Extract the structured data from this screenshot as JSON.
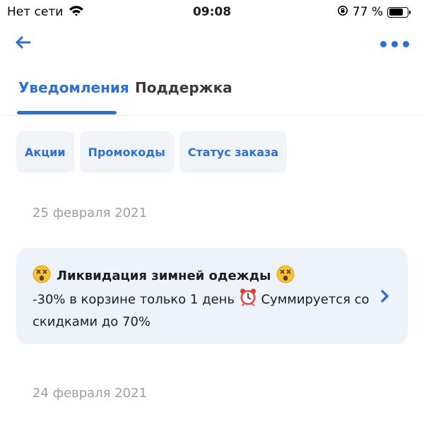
{
  "status_bar": {
    "network": "Нет сети",
    "time": "09:08",
    "battery": "77 %",
    "battery_level": 0.77
  },
  "tabs": [
    {
      "label": "Уведомления",
      "active": true
    },
    {
      "label": "Поддержка",
      "active": false
    }
  ],
  "filters": [
    {
      "label": "Акции"
    },
    {
      "label": "Промокоды"
    },
    {
      "label": "Статус заказа"
    }
  ],
  "notifications": {
    "date_1": "25 февраля 2021",
    "card": {
      "title": "Ликвидация зимней одежды",
      "body_part1": "-30% в корзине только 1 день",
      "body_part2": "Суммируется со скидками до 70%"
    },
    "date_2": "24 февраля 2021"
  },
  "colors": {
    "accent": "#2f6fcf",
    "card_background": "#eef3fb",
    "chip_background": "#f0f3f7",
    "date_text": "#9a9ea6"
  },
  "icons": {
    "wifi": "wifi-icon",
    "orientation_lock": "orientation-lock-icon",
    "battery": "battery-icon",
    "back": "back-arrow-icon",
    "more": "more-dots-icon",
    "title_emoji": "dizzy-face-emoji-icon",
    "clock_emoji": "alarm-clock-emoji-icon",
    "chevron": "chevron-right-icon"
  }
}
